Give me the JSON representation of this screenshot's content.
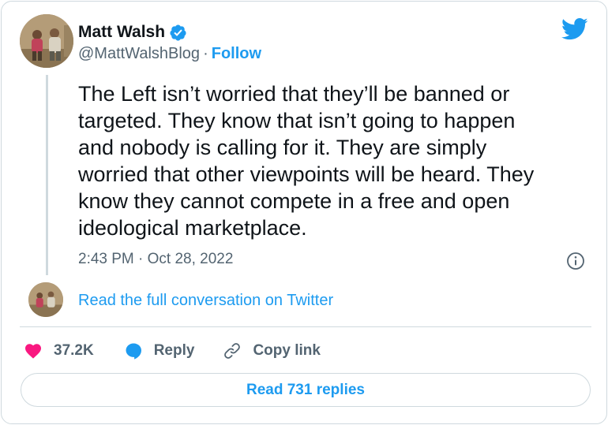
{
  "author": {
    "name": "Matt Walsh",
    "handle": "@MattWalshBlog",
    "separator": "·",
    "follow_label": "Follow",
    "verified": true
  },
  "tweet": {
    "text": "The Left isn’t worried that they’ll be banned or\ntargeted. They know that isn’t going to happen\nand nobody is calling for it. They are simply\nworried that other viewpoints will be heard. They\nknow they cannot compete in a free and open\nideological marketplace.",
    "timestamp": "2:43 PM · Oct 28, 2022"
  },
  "conversation": {
    "link_label": "Read the full conversation on Twitter"
  },
  "actions": {
    "like_count": "37.2K",
    "reply_label": "Reply",
    "copy_link_label": "Copy link"
  },
  "replies_button": "Read 731 replies",
  "colors": {
    "accent": "#1d9bf0",
    "like": "#f91880",
    "text": "#0f1419",
    "muted": "#536471",
    "border": "#cfd9de"
  },
  "icons": [
    "twitter-bird-icon",
    "verified-badge-icon",
    "info-icon",
    "heart-icon",
    "reply-bubble-icon",
    "link-icon"
  ]
}
